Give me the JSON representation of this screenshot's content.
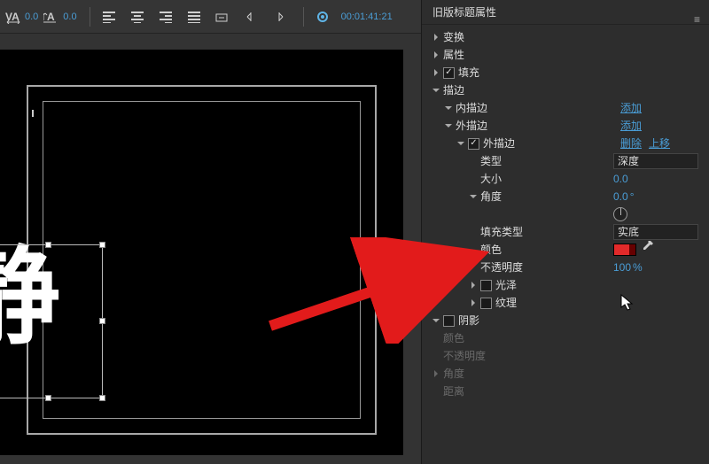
{
  "toolbar": {
    "kern_value": "0.0",
    "baseline_value": "0.0",
    "timecode": "00:01:41:21"
  },
  "preview": {
    "text": "静"
  },
  "panel": {
    "title": "旧版标题属性",
    "transform": "变换",
    "properties": "属性",
    "fill": "填充",
    "stroke": "描边",
    "inner_stroke": "内描边",
    "outer_stroke": "外描边",
    "outer_stroke_item": "外描边",
    "add": "添加",
    "delete": "删除",
    "move_up": "上移",
    "type": "类型",
    "type_value": "深度",
    "size": "大小",
    "size_value": "0.0",
    "angle": "角度",
    "angle_value": "0.0",
    "angle_unit": "°",
    "fill_type": "填充类型",
    "fill_type_value": "实底",
    "color": "颜色",
    "opacity": "不透明度",
    "opacity_value": "100",
    "opacity_unit": " %",
    "sheen": "光泽",
    "texture": "纹理",
    "shadow": "阴影",
    "shadow_color": "颜色",
    "shadow_opacity": "不透明度",
    "shadow_angle": "角度",
    "shadow_distance": "距离"
  }
}
